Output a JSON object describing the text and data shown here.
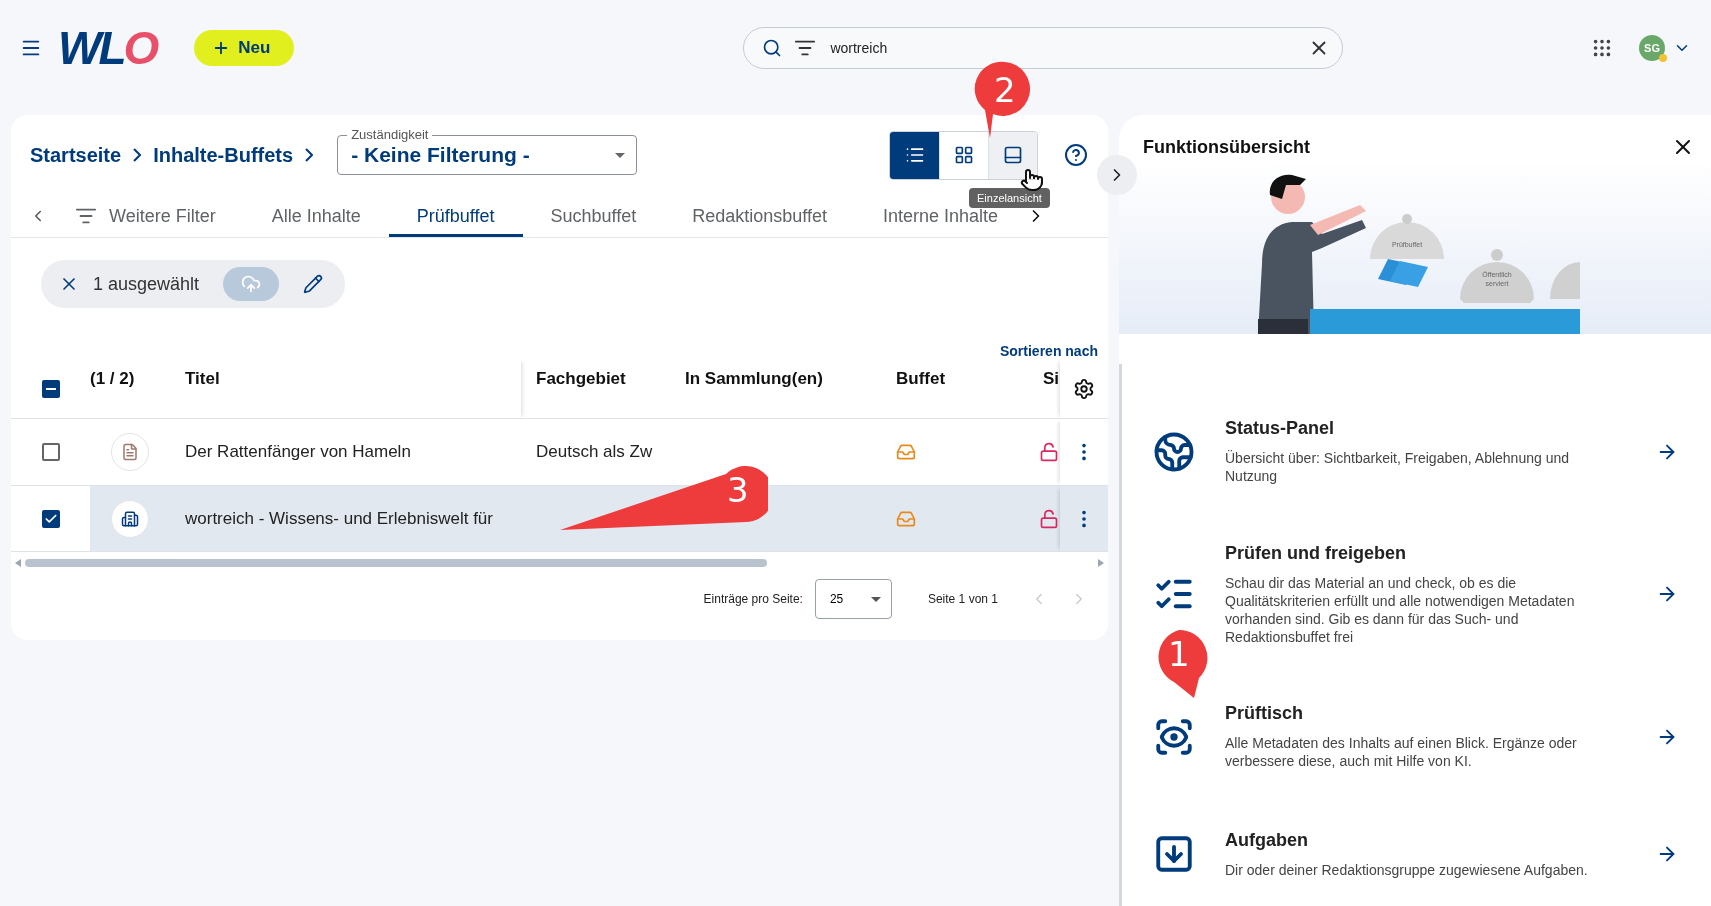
{
  "header": {
    "logo": "WLO",
    "new_button": "Neu",
    "search": {
      "value": "wortreich"
    },
    "avatar": "SG"
  },
  "breadcrumb": [
    "Startseite",
    "Inhalte-Buffets"
  ],
  "filter_select": {
    "label": "Zuständigkeit",
    "value": "- Keine Filterung -"
  },
  "view_modes": [
    {
      "kind": "list",
      "selected": true
    },
    {
      "kind": "grid",
      "selected": false,
      "hovered": false
    },
    {
      "kind": "single",
      "selected": false,
      "hovered": true
    }
  ],
  "tooltip": "Einzelansicht",
  "tabs": [
    {
      "kind": "filter",
      "label": "Weitere Filter",
      "selected": false
    },
    {
      "kind": "tab",
      "label": "Alle Inhalte",
      "selected": false
    },
    {
      "kind": "tab",
      "label": "Prüfbuffet",
      "selected": true
    },
    {
      "kind": "tab",
      "label": "Suchbuffet",
      "selected": false
    },
    {
      "kind": "tab",
      "label": "Redaktionsbuffet",
      "selected": false
    },
    {
      "kind": "tab",
      "label": "Interne Inhalte",
      "selected": false
    }
  ],
  "selection": {
    "label": "1 ausgewählt"
  },
  "sort_label": "Sortieren nach",
  "table": {
    "select_all_partial": true,
    "count": "(1 / 2)",
    "columns": [
      "Titel",
      "Fachgebiet",
      "In Sammlung(en)",
      "Buffet",
      "Si"
    ],
    "rows": [
      {
        "checked": false,
        "selected": false,
        "kind": "text",
        "title": "Der Rattenfänger von Hameln",
        "subject": "Deutsch als Zw"
      },
      {
        "checked": true,
        "selected": true,
        "kind": "building",
        "title": "wortreich - Wissens- und Erlebniswelt für"
      }
    ]
  },
  "paginator": {
    "label": "Einträge pro Seite:",
    "page_size": "25",
    "range": "Seite 1 von 1"
  },
  "panel": {
    "title": "Funktionsübersicht",
    "illustration_labels": [
      "Prüfbuffet",
      "Öffentlich serviert"
    ],
    "items": [
      {
        "kind": "globe",
        "title": "Status-Panel",
        "text": "Übersicht über: Sichtbarkeit, Freigaben, Ablehnung und Nutzung"
      },
      {
        "kind": "checklist",
        "title": "Prüfen und freigeben",
        "text": "Schau dir das Material an und check, ob es die Qualitätskriterien erfüllt und alle notwendigen Metadaten vorhanden sind. Gib es dann für das Such- und Redaktionsbuffet frei"
      },
      {
        "kind": "inspect",
        "title": "Prüftisch",
        "text": "Alle Metadaten des Inhalts auf einen Blick. Ergänze oder verbessere diese, auch mit Hilfe von KI."
      },
      {
        "kind": "tasks",
        "title": "Aufgaben",
        "text": "Dir oder deiner Redaktionsgruppe zugewiesene Aufgaben."
      }
    ]
  },
  "callouts": [
    {
      "kind": "pin",
      "label": "2"
    },
    {
      "kind": "arrow",
      "label": "3"
    },
    {
      "kind": "pin",
      "label": "1"
    }
  ]
}
